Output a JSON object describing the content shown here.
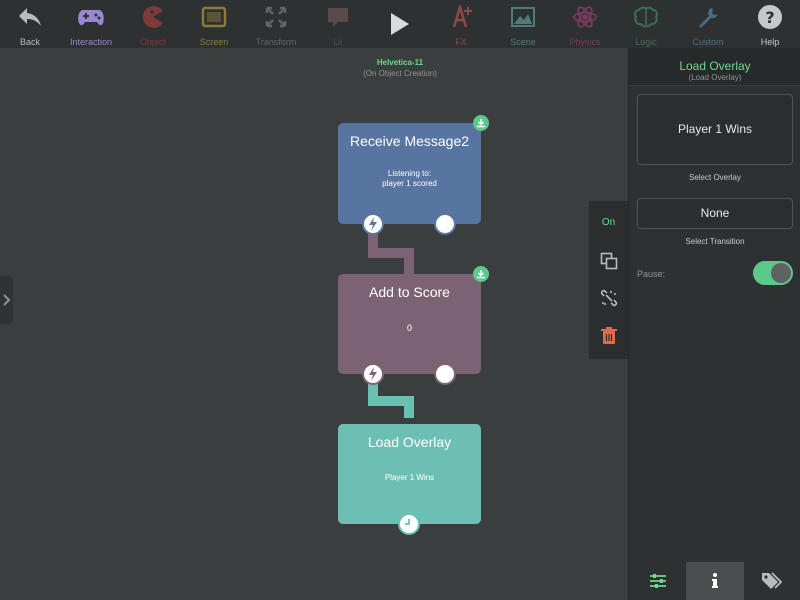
{
  "toolbar": {
    "items": [
      {
        "label": "Back",
        "icon": "back-arrow-icon",
        "color": "#b9bcbd"
      },
      {
        "label": "Interaction",
        "icon": "gamepad-icon",
        "color": "#9b87d1"
      },
      {
        "label": "Object",
        "icon": "pacman-icon",
        "color": "#7d3a3a"
      },
      {
        "label": "Screen",
        "icon": "screen-frame-icon",
        "color": "#8a7a3c"
      },
      {
        "label": "Transform",
        "icon": "expand-arrows-icon",
        "color": "#5f6566"
      },
      {
        "label": "UI",
        "icon": "speech-bubble-icon",
        "color": "#5b4a4a"
      },
      {
        "label": "",
        "icon": "play-icon",
        "color": "#d8dadb"
      },
      {
        "label": "FX",
        "icon": "fx-icon",
        "color": "#8f4848"
      },
      {
        "label": "Scene",
        "icon": "picture-icon",
        "color": "#4f7b7a"
      },
      {
        "label": "Physics",
        "icon": "atom-icon",
        "color": "#7a3a5c"
      },
      {
        "label": "Logic",
        "icon": "brain-icon",
        "color": "#3e6e50"
      },
      {
        "label": "Custom",
        "icon": "wrench-icon",
        "color": "#4b6c86"
      },
      {
        "label": "Help",
        "icon": "help-icon",
        "color": "#c6c9ca"
      }
    ]
  },
  "canvas": {
    "object_name": "Helvetica-11",
    "trigger": "(On Object Creation)"
  },
  "nodes": [
    {
      "title": "Receive Message2",
      "detail_line1": "Listening to:",
      "detail_line2": "player 1 scored",
      "color": "#5874a1"
    },
    {
      "title": "Add to Score",
      "detail_line1": "0",
      "detail_line2": "",
      "color": "#7c6373"
    },
    {
      "title": "Load Overlay",
      "detail_line1": "Player 1 Wins",
      "detail_line2": "",
      "color": "#6cc0b3"
    }
  ],
  "tool_strip": {
    "on_label": "On",
    "icons": [
      "duplicate-icon",
      "unlink-icon",
      "trash-icon"
    ]
  },
  "panel": {
    "title": "Load Overlay",
    "subtitle": "(Load Overlay)",
    "overlay_value": "Player 1 Wins",
    "overlay_caption": "Select Overlay",
    "transition_value": "None",
    "transition_caption": "Select Transition",
    "pause_label": "Pause:",
    "pause_on": true,
    "tabs": [
      "sliders-icon",
      "info-icon",
      "tags-icon"
    ]
  }
}
